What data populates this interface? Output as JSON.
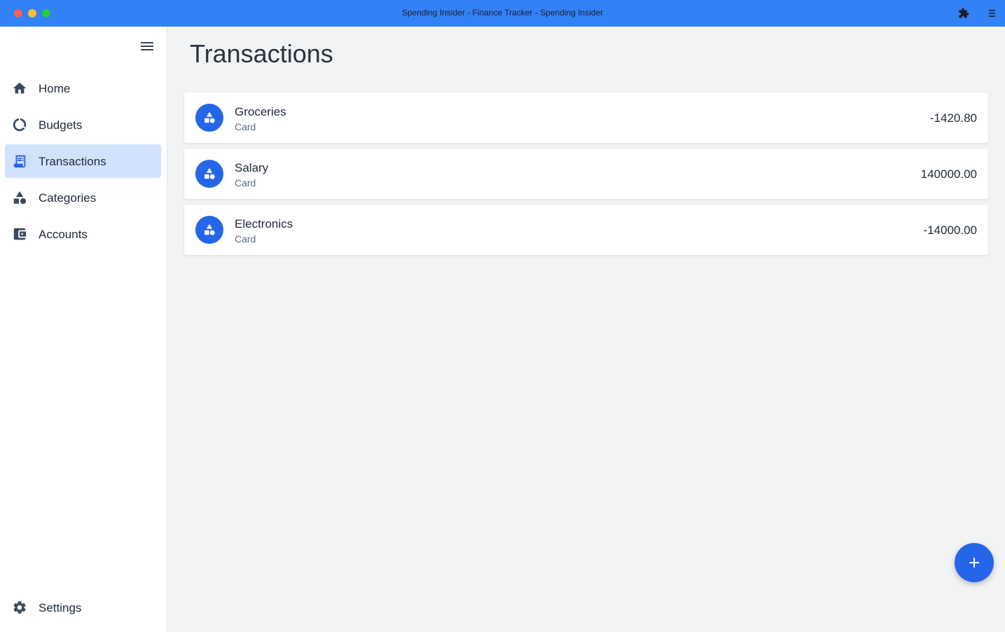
{
  "window": {
    "title": "Spending Insider - Finance Tracker - Spending Insider"
  },
  "sidebar": {
    "items": [
      {
        "label": "Home",
        "icon": "home-icon",
        "active": false
      },
      {
        "label": "Budgets",
        "icon": "budget-ring-icon",
        "active": false
      },
      {
        "label": "Transactions",
        "icon": "receipt-icon",
        "active": true
      },
      {
        "label": "Categories",
        "icon": "shapes-icon",
        "active": false
      },
      {
        "label": "Accounts",
        "icon": "wallet-icon",
        "active": false
      }
    ],
    "settings": {
      "label": "Settings",
      "icon": "gear-icon"
    }
  },
  "main": {
    "title": "Transactions",
    "transactions": [
      {
        "name": "Groceries",
        "account": "Card",
        "amount": "-1420.80",
        "icon": "shapes-icon"
      },
      {
        "name": "Salary",
        "account": "Card",
        "amount": "140000.00",
        "icon": "shapes-icon"
      },
      {
        "name": "Electronics",
        "account": "Card",
        "amount": "-14000.00",
        "icon": "shapes-icon"
      }
    ]
  },
  "fab": {
    "icon": "plus-icon"
  },
  "colors": {
    "titlebar": "#3381f6",
    "accent": "#2565e8",
    "active_nav": "#d2e2fc",
    "background": "#f2f3f5"
  }
}
